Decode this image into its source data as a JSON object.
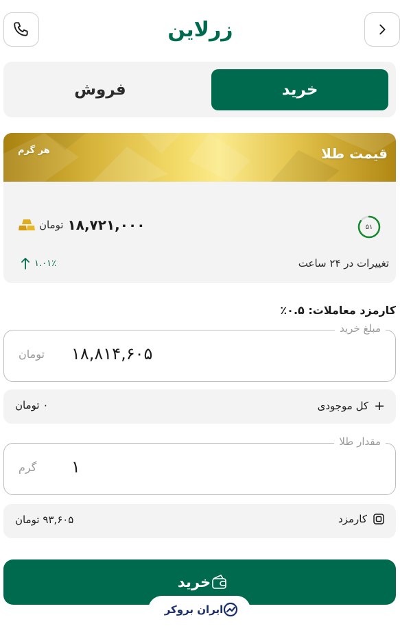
{
  "header": {
    "logo_text": "زرلاین",
    "back_icon": "chevron-right-icon",
    "phone_icon": "phone-icon"
  },
  "tabs": [
    {
      "label": "خرید",
      "active": true
    },
    {
      "label": "فروش",
      "active": false
    }
  ],
  "price_card": {
    "title": "قیمت طلا",
    "unit_label": "هر گرم",
    "price": "۱۸,۷۲۱,۰۰۰",
    "currency": "تومان",
    "timer": "۵۱",
    "change_label": "تغییرات در ۲۴ ساعت",
    "change_value": "۱.۰۱٪"
  },
  "fee_note": "کارمزد معاملات: ۰.۵٪",
  "amount_field": {
    "label": "مبلغ خرید",
    "value": "۱۸,۸۱۴,۶۰۵",
    "unit": "تومان"
  },
  "balance_row": {
    "label": "کل موجودی",
    "value": "۰ تومان"
  },
  "gold_field": {
    "label": "مقدار طلا",
    "value": "۱",
    "unit": "گرم"
  },
  "fee_row": {
    "label": "کارمزد",
    "value": "۹۳,۶۰۵ تومان"
  },
  "submit": {
    "label": "خرید"
  },
  "brand": {
    "text": "ایران بروکر"
  },
  "colors": {
    "primary": "#006a4e",
    "gold": "#e2c24a",
    "surface": "#f3f3f3"
  }
}
